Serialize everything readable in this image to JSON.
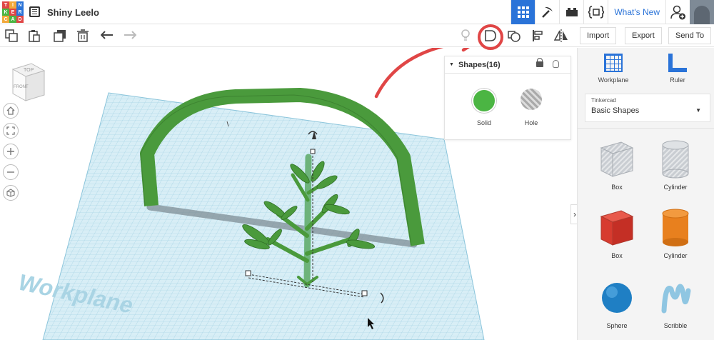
{
  "app": {
    "logo_letters": [
      "T",
      "I",
      "N",
      "K",
      "E",
      "R",
      "C",
      "A",
      "D"
    ],
    "logo_colors": [
      "#e04646",
      "#f2a93b",
      "#2a73d8",
      "#4bb543",
      "#e04646",
      "#2a73d8",
      "#f2a93b",
      "#4bb543",
      "#e04646"
    ],
    "design_title": "Shiny Leelo",
    "whats_new": "What's New"
  },
  "toolbar": {
    "import_label": "Import",
    "export_label": "Export",
    "send_to_label": "Send To"
  },
  "viewcube": {
    "top_label": "TOP",
    "front_label": "FRONT"
  },
  "viewport": {
    "workplane_label": "Workplane"
  },
  "shapes_panel": {
    "title": "Shapes(16)",
    "solid_label": "Solid",
    "hole_label": "Hole"
  },
  "right_panel": {
    "workplane_label": "Workplane",
    "ruler_label": "Ruler",
    "library_sub": "Tinkercad",
    "library_main": "Basic Shapes",
    "shapes": [
      {
        "label": "Box"
      },
      {
        "label": "Cylinder"
      },
      {
        "label": "Box"
      },
      {
        "label": "Cylinder"
      },
      {
        "label": "Sphere"
      },
      {
        "label": "Scribble"
      }
    ]
  },
  "colors": {
    "accent": "#2a73d8",
    "solid": "#4bb543",
    "highlight": "#e04646",
    "plant": "#4a9a3c"
  }
}
